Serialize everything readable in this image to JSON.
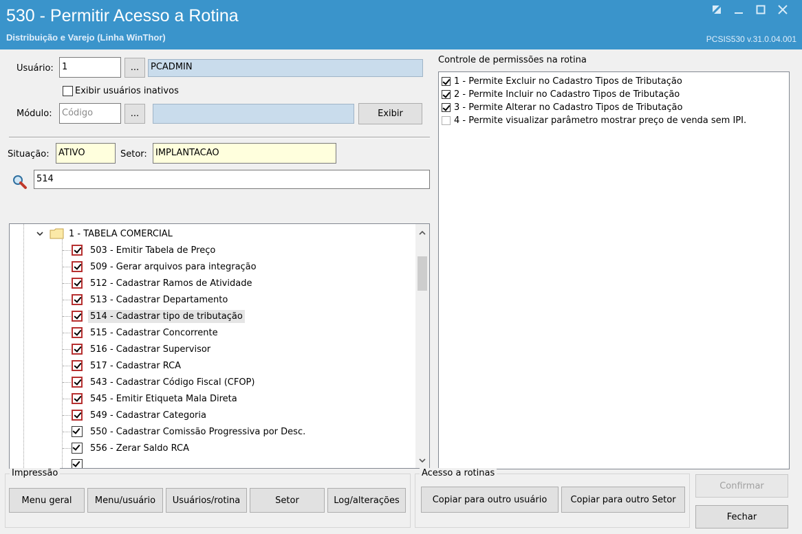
{
  "window": {
    "title": "530 - Permitir Acesso a Rotina",
    "subtitle": "Distribuição e Varejo (Linha WinThor)",
    "version": "PCSIS530  v.31.0.04.001"
  },
  "user": {
    "label": "Usuário:",
    "code": "1",
    "browse": "...",
    "name": "PCADMIN",
    "show_inactive_label": "Exibir usuários inativos",
    "show_inactive": false
  },
  "module": {
    "label": "Módulo:",
    "code_placeholder": "Código",
    "browse": "...",
    "name": "",
    "show_button": "Exibir"
  },
  "status": {
    "situacao_label": "Situação:",
    "situacao": "ATIVO",
    "setor_label": "Setor:",
    "setor": "IMPLANTACAO"
  },
  "search": {
    "value": "514"
  },
  "tree": {
    "folder": "1 - TABELA COMERCIAL",
    "items": [
      {
        "label": "503 - Emitir Tabela de Preço",
        "checked": true,
        "red": true
      },
      {
        "label": "509 - Gerar arquivos para integração",
        "checked": true,
        "red": true
      },
      {
        "label": "512 - Cadastrar Ramos de Atividade",
        "checked": true,
        "red": true
      },
      {
        "label": "513 - Cadastrar Departamento",
        "checked": true,
        "red": true
      },
      {
        "label": "514 - Cadastrar tipo de tributação",
        "checked": true,
        "red": true,
        "selected": true
      },
      {
        "label": "515 - Cadastrar Concorrente",
        "checked": true,
        "red": true
      },
      {
        "label": "516 - Cadastrar Supervisor",
        "checked": true,
        "red": true
      },
      {
        "label": "517 - Cadastrar RCA",
        "checked": true,
        "red": true
      },
      {
        "label": "543 - Cadastrar Código Fiscal (CFOP)",
        "checked": true,
        "red": true
      },
      {
        "label": "545 - Emitir Etiqueta Mala Direta",
        "checked": true,
        "red": true
      },
      {
        "label": "549 - Cadastrar Categoria",
        "checked": true,
        "red": true
      },
      {
        "label": "550 - Cadastrar Comissão Progressiva por Desc.",
        "checked": true,
        "red": false
      },
      {
        "label": "556 - Zerar Saldo RCA",
        "checked": true,
        "red": false
      }
    ]
  },
  "permissions": {
    "title": "Controle de permissões na rotina",
    "items": [
      {
        "label": "1 - Permite Excluir no Cadastro Tipos de Tributação",
        "checked": true
      },
      {
        "label": "2 - Permite Incluir no Cadastro Tipos de Tributação",
        "checked": true
      },
      {
        "label": "3 - Permite Alterar no Cadastro Tipos de Tributação",
        "checked": true
      },
      {
        "label": "4 - Permite visualizar parâmetro mostrar preço de venda sem IPI.",
        "checked": false
      }
    ]
  },
  "impressao": {
    "title": "Impressão",
    "buttons": [
      "Menu geral",
      "Menu/usuário",
      "Usuários/rotina",
      "Setor",
      "Log/alterações"
    ]
  },
  "acesso": {
    "title": "Acesso a rotinas",
    "buttons": [
      "Copiar para outro usuário",
      "Copiar para outro Setor"
    ]
  },
  "actions": {
    "confirm": "Confirmar",
    "close": "Fechar"
  }
}
